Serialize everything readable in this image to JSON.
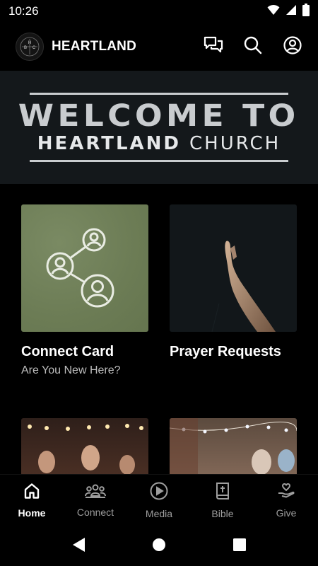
{
  "status_bar": {
    "time": "10:26"
  },
  "app_bar": {
    "title": "HEARTLAND",
    "logo_letters": [
      "H",
      "B",
      "C"
    ]
  },
  "banner": {
    "line1": "WELCOME TO",
    "line2_strong": "HEARTLAND",
    "line2_light": "CHURCH"
  },
  "cards": [
    {
      "title": "Connect Card",
      "subtitle": "Are You New Here?"
    },
    {
      "title": "Prayer Requests",
      "subtitle": ""
    }
  ],
  "bottom_nav": [
    {
      "label": "Home",
      "icon": "home-icon",
      "active": true
    },
    {
      "label": "Connect",
      "icon": "people-icon",
      "active": false
    },
    {
      "label": "Media",
      "icon": "play-circle-icon",
      "active": false
    },
    {
      "label": "Bible",
      "icon": "bible-icon",
      "active": false
    },
    {
      "label": "Give",
      "icon": "give-hand-icon",
      "active": false
    }
  ],
  "colors": {
    "background": "#000000",
    "banner_bg": "#14181b",
    "banner_text": "#c9cccf",
    "connect_card_bg": "#71815a",
    "nav_active": "#ffffff",
    "nav_inactive": "#9e9e9e"
  }
}
